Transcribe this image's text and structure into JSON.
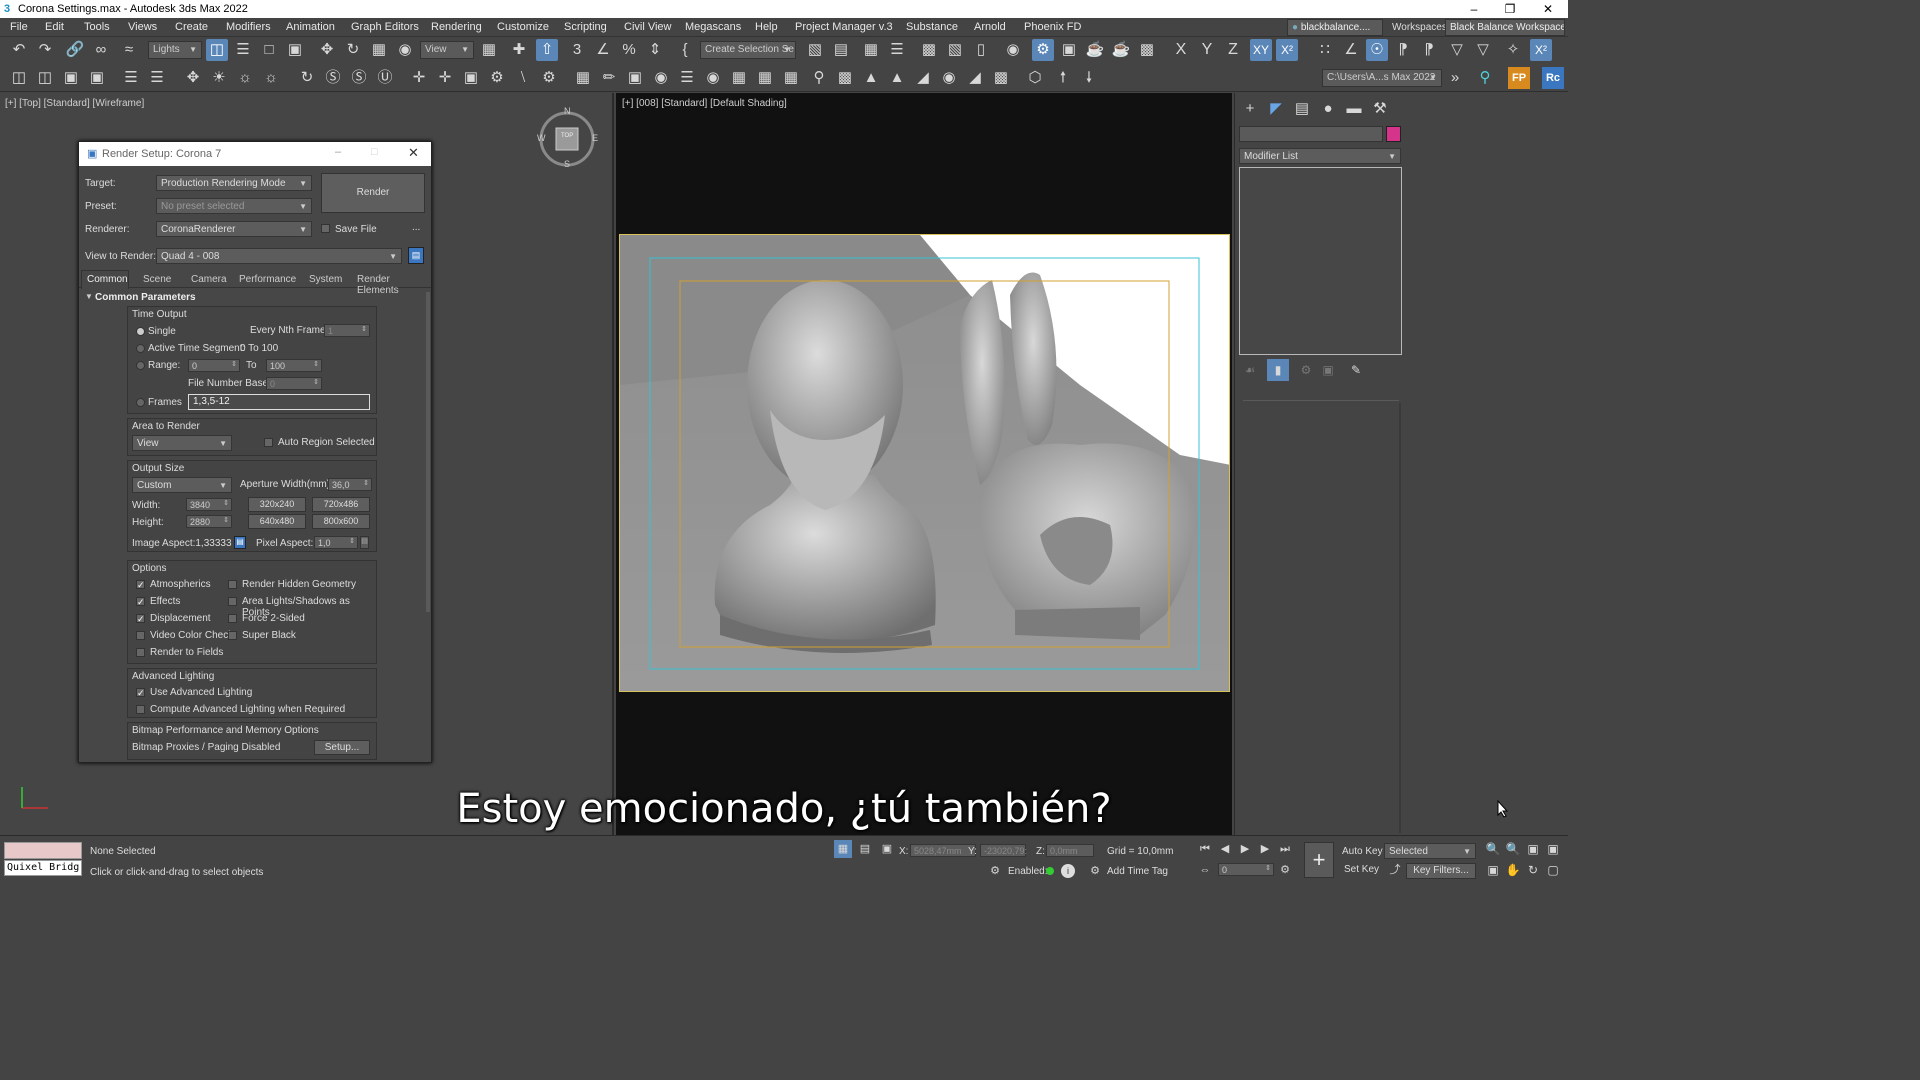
{
  "window": {
    "title": "Corona Settings.max - Autodesk 3ds Max 2022"
  },
  "menu": [
    "File",
    "Edit",
    "Tools",
    "Views",
    "Create",
    "Modifiers",
    "Animation",
    "Graph Editors",
    "Rendering",
    "Customize",
    "Scripting",
    "Civil View",
    "Megascans",
    "Help",
    "Project Manager v.3",
    "Substance",
    "Arnold",
    "Phoenix FD"
  ],
  "account": {
    "user": "blackbalance....",
    "workspaces_label": "Workspaces:",
    "workspace": "Black Balance Workspace"
  },
  "toolbar": {
    "filter": "Lights",
    "ref_coord": "View",
    "selection_set": "Create Selection Se",
    "axis_x": "X",
    "axis_y": "Y",
    "axis_z": "Z",
    "axis_xy": "XY",
    "project_path": "C:\\Users\\A...s Max 2022"
  },
  "viewports": {
    "left_label": "[+] [Top] [Standard] [Wireframe]",
    "right_label": "[+] [008] [Standard] [Default Shading]",
    "viewcube": {
      "top": "TOP",
      "n": "N",
      "s": "S",
      "w": "W",
      "e": "E"
    }
  },
  "render_setup": {
    "title": "Render Setup: Corona 7",
    "target_label": "Target:",
    "target": "Production Rendering Mode",
    "preset_label": "Preset:",
    "preset": "No preset selected",
    "renderer_label": "Renderer:",
    "renderer": "CoronaRenderer",
    "save_file": "Save File",
    "more": "...",
    "render_button": "Render",
    "view_label": "View to Render:",
    "view": "Quad 4 - 008",
    "tabs": [
      "Common",
      "Scene",
      "Camera",
      "Performance",
      "System",
      "Render Elements"
    ],
    "section": "Common Parameters",
    "time_output": {
      "title": "Time Output",
      "single": "Single",
      "every_nth": "Every Nth Frame:",
      "every_nth_value": "1",
      "active_segment": "Active Time Segment:",
      "active_segment_value": "0 To 100",
      "range": "Range:",
      "range_from": "0",
      "range_to_label": "To",
      "range_to": "100",
      "file_number_base": "File Number Base:",
      "file_number_base_value": "0",
      "frames": "Frames",
      "frames_value": "1,3,5-12"
    },
    "area": {
      "title": "Area to Render",
      "mode": "View",
      "auto_region": "Auto Region Selected"
    },
    "output_size": {
      "title": "Output Size",
      "preset": "Custom",
      "aperture_label": "Aperture Width(mm):",
      "aperture": "36,0",
      "width_label": "Width:",
      "width": "3840",
      "height_label": "Height:",
      "height": "2880",
      "presets": [
        "320x240",
        "720x486",
        "640x480",
        "800x600"
      ],
      "image_aspect": "Image Aspect:1,33333",
      "pixel_aspect_label": "Pixel Aspect:",
      "pixel_aspect": "1,0"
    },
    "options": {
      "title": "Options",
      "items": [
        {
          "label": "Atmospherics",
          "checked": true
        },
        {
          "label": "Effects",
          "checked": true
        },
        {
          "label": "Displacement",
          "checked": true
        },
        {
          "label": "Video Color Check",
          "checked": false
        },
        {
          "label": "Render to Fields",
          "checked": false
        }
      ],
      "items_right": [
        {
          "label": "Render Hidden Geometry",
          "checked": false
        },
        {
          "label": "Area Lights/Shadows as Points",
          "checked": false
        },
        {
          "label": "Force 2-Sided",
          "checked": false
        },
        {
          "label": "Super Black",
          "checked": false
        }
      ]
    },
    "advanced_lighting": {
      "title": "Advanced Lighting",
      "use": "Use Advanced Lighting",
      "use_checked": true,
      "compute": "Compute Advanced Lighting when Required",
      "compute_checked": false
    },
    "bitmap": {
      "title": "Bitmap Performance and Memory Options",
      "status": "Bitmap Proxies / Paging Disabled",
      "setup": "Setup..."
    }
  },
  "command_panel": {
    "modifier_list": "Modifier List",
    "color_swatch": "#d6338a"
  },
  "status": {
    "selection": "None Selected",
    "prompt": "Click or click-and-drag to select objects",
    "script_listener": "Quixel Bridg",
    "x_label": "X:",
    "x": "5028,47mm",
    "y_label": "Y:",
    "y": "-23020,79:",
    "z_label": "Z:",
    "z": "0,0mm",
    "grid": "Grid = 10,0mm",
    "enabled": "Enabled:",
    "add_time_tag": "Add Time Tag",
    "auto_key": "Auto Key",
    "set_key": "Set Key",
    "key_mode": "Selected",
    "key_filters": "Key Filters...",
    "frame": "0"
  },
  "subtitle": "Estoy emocionado, ¿tú también?"
}
